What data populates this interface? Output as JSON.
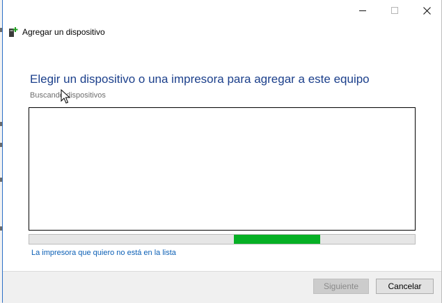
{
  "window": {
    "title": "Agregar un dispositivo",
    "heading": "Elegir un dispositivo o una impresora para agregar a este equipo",
    "status": "Buscando dispositivos",
    "progress": {
      "start_fraction": 0.53,
      "end_fraction": 0.755,
      "color": "#06b025"
    },
    "printer_link": "La impresora que quiero no está en la lista",
    "buttons": {
      "next": "Siguiente",
      "cancel": "Cancelar"
    }
  }
}
